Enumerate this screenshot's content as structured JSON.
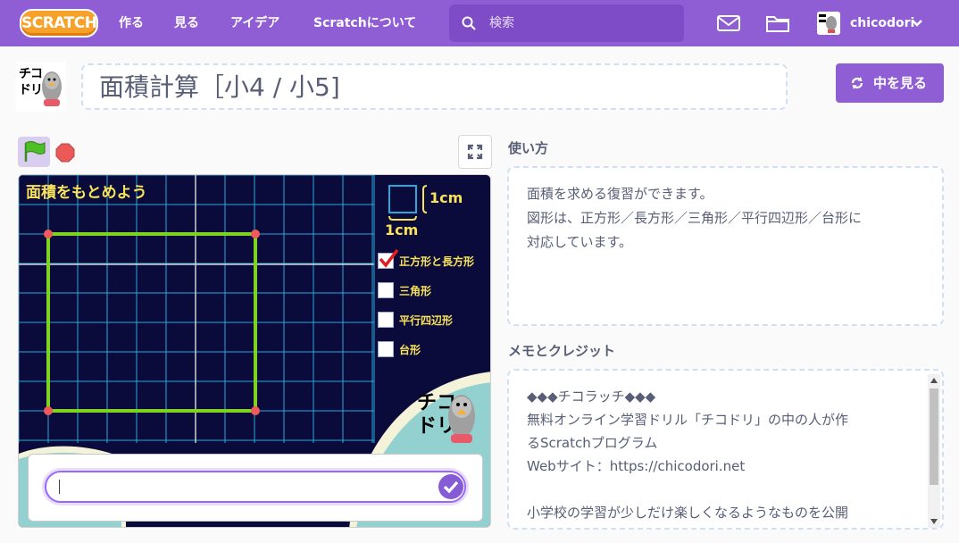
{
  "nav": {
    "logo": "SCRATCH",
    "items": [
      "作る",
      "見る",
      "アイデア",
      "Scratchについて"
    ],
    "search_placeholder": "検索",
    "username": "chicodori"
  },
  "project": {
    "title": "面積計算［小4 / 小5]",
    "see_inside": "中を見る"
  },
  "stage": {
    "heading": "面積をもとめよう",
    "unit_right": "1cm",
    "unit_bottom": "1cm",
    "options": [
      {
        "label": "正方形と長方形",
        "checked": true
      },
      {
        "label": "三角形",
        "checked": false
      },
      {
        "label": "平行四辺形",
        "checked": false
      },
      {
        "label": "台形",
        "checked": false
      }
    ],
    "logo_text": "チコドリ"
  },
  "instructions": {
    "heading": "使い方",
    "lines": [
      "面積を求める復習ができます。",
      "図形は、正方形／長方形／三角形／平行四辺形／台形に",
      "対応しています。"
    ]
  },
  "notes": {
    "heading": "メモとクレジット",
    "lines": [
      "◆◆◆チコラッチ◆◆◆",
      "無料オンライン学習ドリル「チコドリ」の中の人が作",
      "るScratchプログラム",
      "Webサイト：https://chicodori.net",
      "",
      "小学校の学習が少しだけ楽しくなるようなものを公開"
    ]
  },
  "colors": {
    "nav": "#8f5ed4",
    "stage_bg": "#0b0b3b",
    "grid": "#2aa8d8",
    "shape": "#7ed321",
    "label": "#f8e35a"
  }
}
